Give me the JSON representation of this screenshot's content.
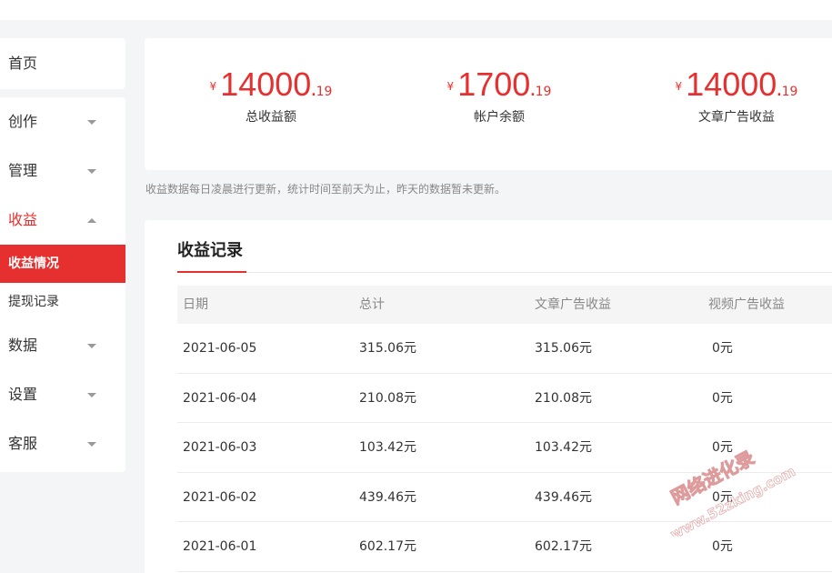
{
  "sidebar": {
    "home": "首页",
    "groups": [
      {
        "label": "创作"
      },
      {
        "label": "管理"
      },
      {
        "label": "收益"
      },
      {
        "label": "数据"
      },
      {
        "label": "设置"
      },
      {
        "label": "客服"
      }
    ],
    "sub_items": [
      "收益情况",
      "提现记录"
    ]
  },
  "stats": [
    {
      "currency": "¥",
      "integer": "14000",
      "dot": ".",
      "decimal": "19",
      "label": "总收益额"
    },
    {
      "currency": "¥",
      "integer": "1700",
      "dot": ".",
      "decimal": "19",
      "label": "帐户余额"
    },
    {
      "currency": "¥",
      "integer": "14000",
      "dot": ".",
      "decimal": "19",
      "label": "文章广告收益"
    }
  ],
  "note": "收益数据每日凌晨进行更新，统计时间至前天为止，昨天的数据暂未更新。",
  "records": {
    "title": "收益记录",
    "columns": [
      "日期",
      "总计",
      "文章广告收益",
      "视频广告收益"
    ],
    "rows": [
      [
        "2021-06-05",
        "315.06元",
        "315.06元",
        "0元"
      ],
      [
        "2021-06-04",
        "210.08元",
        "210.08元",
        "0元"
      ],
      [
        "2021-06-03",
        "103.42元",
        "103.42元",
        "0元"
      ],
      [
        "2021-06-02",
        "439.46元",
        "439.46元",
        "0元"
      ],
      [
        "2021-06-01",
        "602.17元",
        "602.17元",
        "0元"
      ]
    ]
  },
  "watermark": {
    "line1": "网络进化录",
    "line2": "www.52zking.com"
  },
  "colors": {
    "accent": "#e6302f",
    "background": "#f4f5f7"
  }
}
